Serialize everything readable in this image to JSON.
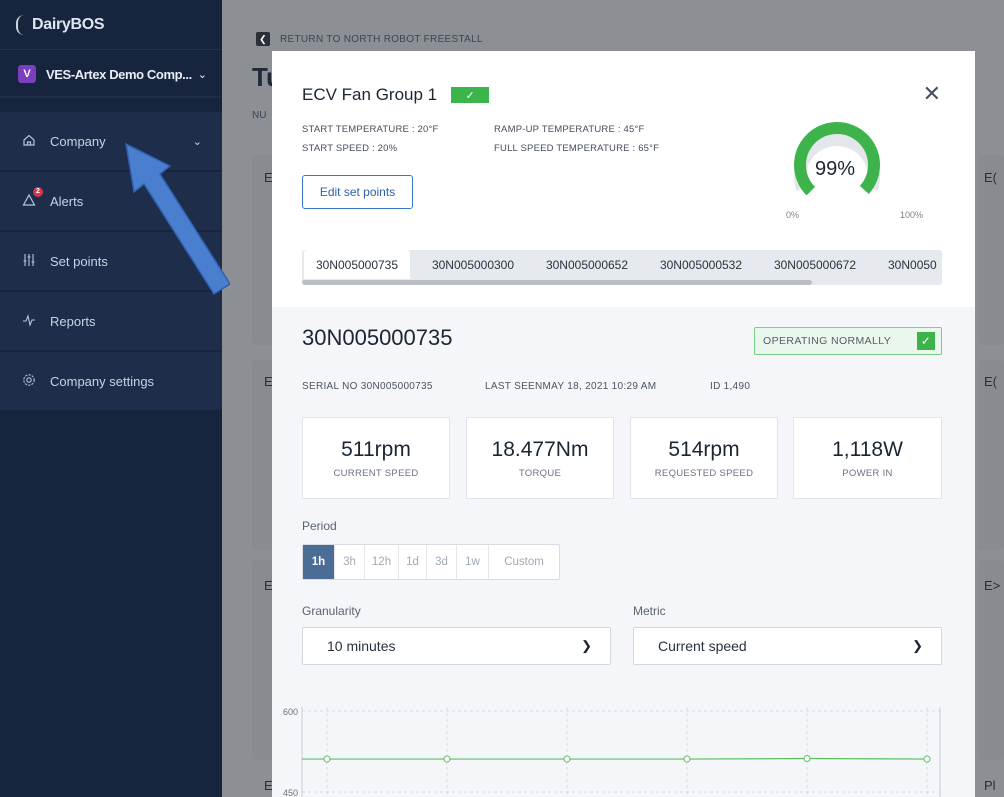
{
  "app": {
    "logo": "DairyBOS"
  },
  "company": {
    "badge": "V",
    "name": "VES-Artex Demo Comp..."
  },
  "sidebar": {
    "items": [
      {
        "label": "Company",
        "icon": "home-icon"
      },
      {
        "label": "Alerts",
        "icon": "alert-icon",
        "badge": "2"
      },
      {
        "label": "Set points",
        "icon": "sliders-icon"
      },
      {
        "label": "Reports",
        "icon": "pulse-icon"
      },
      {
        "label": "Company settings",
        "icon": "gear-icon"
      }
    ]
  },
  "background": {
    "return_link": "RETURN TO NORTH ROBOT FREESTALL",
    "title": "Tu",
    "subtitle": "NU"
  },
  "modal": {
    "title": "ECV Fan Group 1",
    "specs": {
      "start_temperature": "START TEMPERATURE : 20°F",
      "start_speed": "START SPEED : 20%",
      "ramp_up_temperature": "RAMP-UP TEMPERATURE : 45°F",
      "full_speed_temperature": "FULL SPEED TEMPERATURE : 65°F"
    },
    "edit_button": "Edit set points",
    "gauge": {
      "value": "99%",
      "percent": 99,
      "min_label": "0%",
      "max_label": "100%",
      "color": "#3cb44b"
    },
    "tabs": [
      "30N005000735",
      "30N005000300",
      "30N005000652",
      "30N005000532",
      "30N005000672",
      "30N0050"
    ],
    "active_tab": 0,
    "device": {
      "id": "30N005000735",
      "status": "OPERATING NORMALLY",
      "serial": "SERIAL NO 30N005000735",
      "last_seen": "LAST SEENMAY 18, 2021 10:29 AM",
      "record_id": "ID 1,490"
    },
    "metrics": [
      {
        "value": "511rpm",
        "label": "CURRENT SPEED"
      },
      {
        "value": "18.477Nm",
        "label": "TORQUE"
      },
      {
        "value": "514rpm",
        "label": "REQUESTED SPEED"
      },
      {
        "value": "1,118W",
        "label": "POWER IN"
      }
    ],
    "period_label": "Period",
    "periods": [
      "1h",
      "3h",
      "12h",
      "1d",
      "3d",
      "1w",
      "Custom"
    ],
    "active_period": "1h",
    "granularity_label": "Granularity",
    "granularity_value": "10 minutes",
    "metric_label": "Metric",
    "metric_value": "Current speed"
  },
  "chart_data": {
    "type": "line",
    "y_ticks": [
      "600",
      "450"
    ],
    "ylim": [
      450,
      600
    ],
    "values": [
      511,
      511,
      511,
      511,
      512,
      511
    ],
    "color": "#5cbf62"
  }
}
